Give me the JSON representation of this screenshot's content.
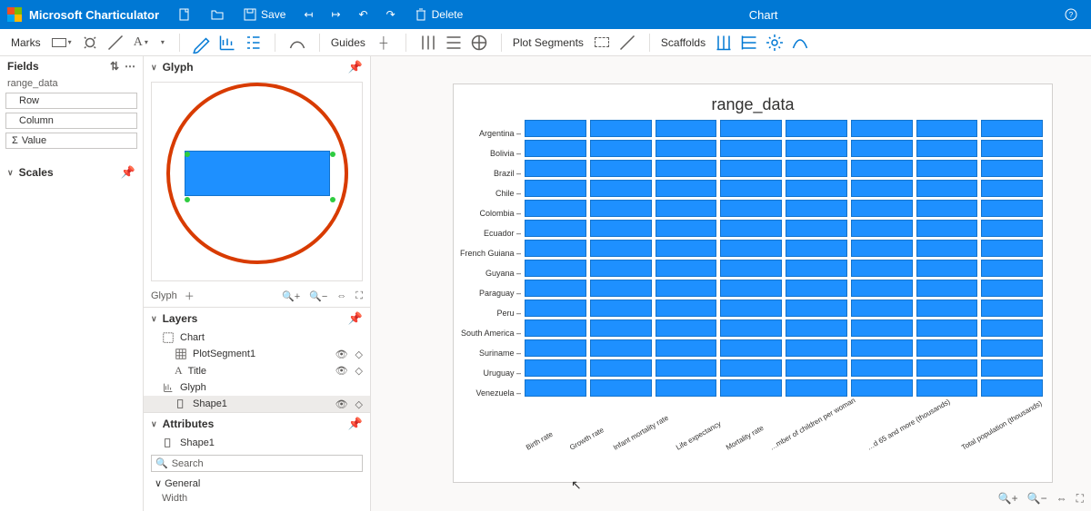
{
  "app": {
    "name": "Microsoft Charticulator",
    "title": "Chart"
  },
  "titlebar": {
    "save": "Save",
    "delete": "Delete"
  },
  "ribbon": {
    "marks": "Marks",
    "guides": "Guides",
    "plot_segments": "Plot Segments",
    "scaffolds": "Scaffolds"
  },
  "fields": {
    "title": "Fields",
    "dataset": "range_data",
    "items": [
      "Row",
      "Column",
      "Value"
    ]
  },
  "scales": {
    "title": "Scales"
  },
  "glyph": {
    "title": "Glyph",
    "tab": "Glyph"
  },
  "layers": {
    "title": "Layers",
    "items": [
      {
        "label": "Chart",
        "level": 1
      },
      {
        "label": "PlotSegment1",
        "level": 2,
        "eye": true,
        "erase": true
      },
      {
        "label": "Title",
        "level": 2,
        "eye": true,
        "erase": true
      },
      {
        "label": "Glyph",
        "level": 1
      },
      {
        "label": "Shape1",
        "level": 2,
        "eye": true,
        "erase": true,
        "selected": true
      }
    ]
  },
  "attributes": {
    "title": "Attributes",
    "selected": "Shape1",
    "search_placeholder": "Search",
    "group": "General",
    "prop": "Width"
  },
  "chart_data": {
    "type": "heatmap",
    "title": "range_data",
    "y_categories": [
      "Argentina",
      "Bolivia",
      "Brazil",
      "Chile",
      "Colombia",
      "Ecuador",
      "French Guiana",
      "Guyana",
      "Paraguay",
      "Peru",
      "South America",
      "Suriname",
      "Uruguay",
      "Venezuela"
    ],
    "x_categories": [
      "Birth rate",
      "Growth rate",
      "Infant mortality rate",
      "Life expectancy",
      "Mortality rate",
      "…mber of children per woman",
      "…d 65 and more (thousands)",
      "Total population (thousands)"
    ],
    "note": "All cells rendered as uniform filled rectangles; individual numeric values not visible in screenshot."
  }
}
